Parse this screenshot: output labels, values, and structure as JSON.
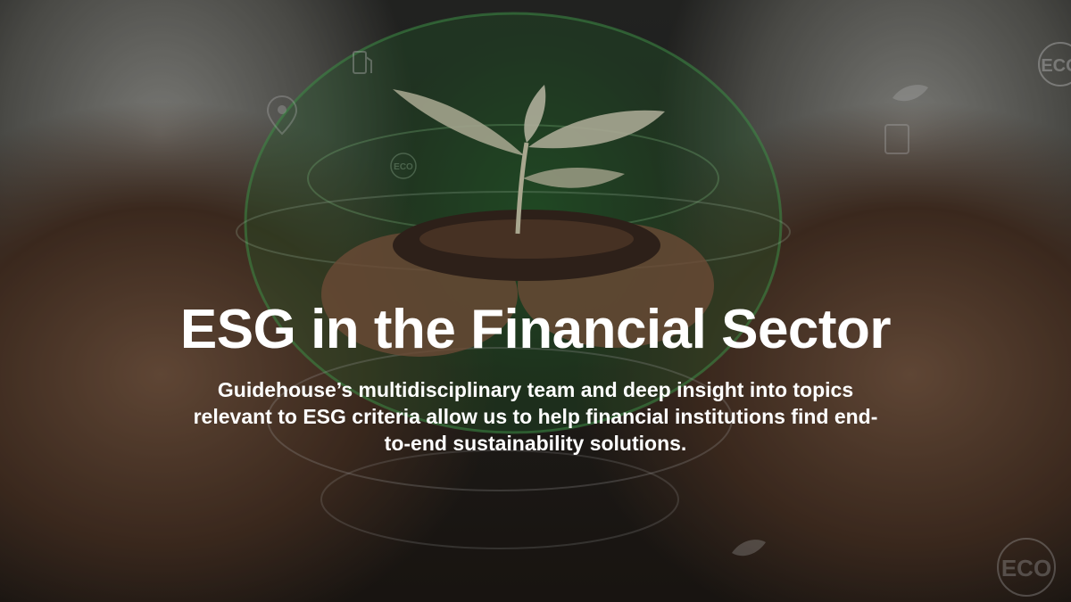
{
  "hero": {
    "title": "ESG in the Financial Sector",
    "description": "Guidehouse’s multidisciplinary team and deep insight into topics relevant to ESG criteria allow us to help financial institutions find end-to-end sustainability solutions.",
    "badges": {
      "eco_top_right": "ECO",
      "eco_bottom_right": "ECO",
      "eco_globe": "ECO"
    },
    "background": {
      "subject": "hands holding a seedling in soil inside a green globe",
      "icons": [
        "eco-badge-icon",
        "leaf-icon",
        "fuel-pump-icon",
        "location-pin-icon"
      ]
    },
    "colors": {
      "text": "#ffffff",
      "globe_green": "#2f8a3a",
      "overlay": "rgba(0,0,0,0.22)"
    }
  }
}
